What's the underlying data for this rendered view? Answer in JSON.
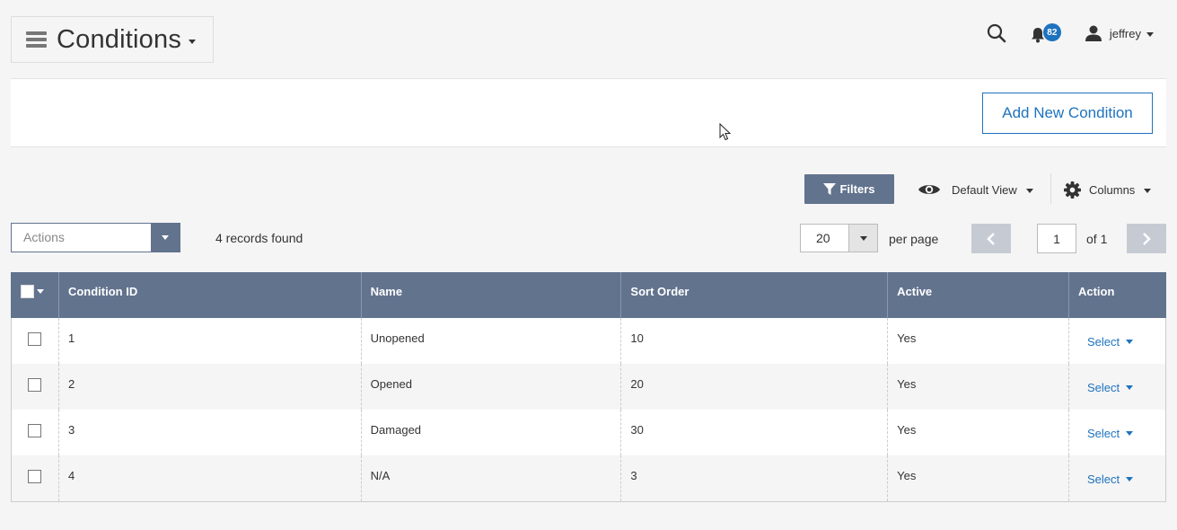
{
  "header": {
    "title": "Conditions",
    "notifications_count": "82",
    "user_name": "jeffrey"
  },
  "toolbar": {
    "add_label": "Add New Condition",
    "filters_label": "Filters",
    "view_label": "Default View",
    "columns_label": "Columns"
  },
  "grid_controls": {
    "actions_placeholder": "Actions",
    "records_found": "4 records found",
    "per_page_value": "20",
    "per_page_label": "per page",
    "current_page": "1",
    "of_pages": "of 1"
  },
  "table": {
    "columns": [
      "Condition ID",
      "Name",
      "Sort Order",
      "Active",
      "Action"
    ],
    "action_label": "Select",
    "rows": [
      {
        "id": "1",
        "name": "Unopened",
        "sort_order": "10",
        "active": "Yes"
      },
      {
        "id": "2",
        "name": "Opened",
        "sort_order": "20",
        "active": "Yes"
      },
      {
        "id": "3",
        "name": "Damaged",
        "sort_order": "30",
        "active": "Yes"
      },
      {
        "id": "4",
        "name": "N/A",
        "sort_order": "3",
        "active": "Yes"
      }
    ]
  },
  "colors": {
    "accent": "#1e73be",
    "header_bg": "#62738e",
    "page_bg": "#f5f5f5"
  },
  "icons": [
    "hamburger-menu-icon",
    "search-icon",
    "bell-icon",
    "user-icon",
    "filter-icon",
    "eye-icon",
    "gear-icon",
    "chevron-left-icon",
    "chevron-right-icon",
    "mouse-pointer-icon"
  ]
}
